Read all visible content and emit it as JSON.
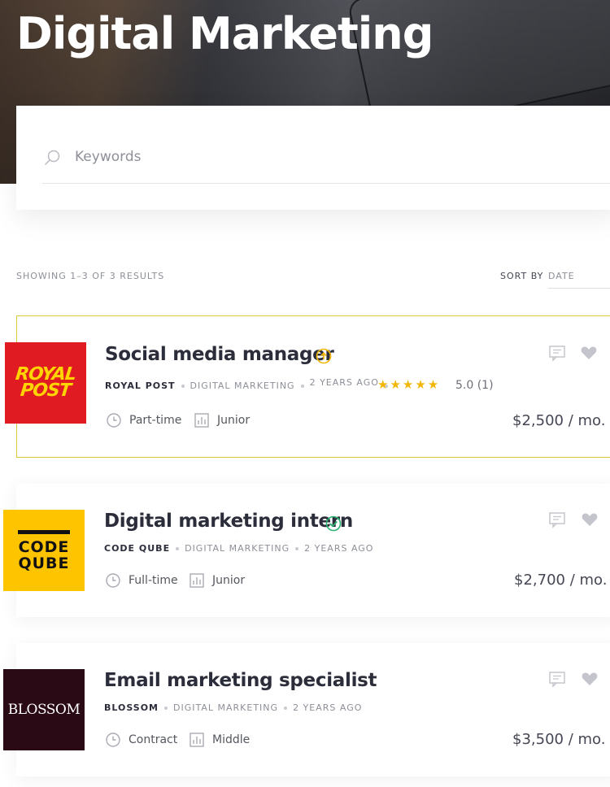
{
  "hero": {
    "title": "Digital Marketing"
  },
  "search": {
    "placeholder": "Keywords"
  },
  "results": {
    "showing": "SHOWING 1–3 OF 3 RESULTS",
    "sort_label": "SORT BY",
    "sort_value": "DATE"
  },
  "jobs": [
    {
      "title": "Social media manager",
      "badge": "featured-arrow-icon",
      "company": "ROYAL POST",
      "category": "DIGITAL MARKETING",
      "posted": "2 YEARS AGO",
      "stars": "★★★★★",
      "rating": "5.0 (1)",
      "type": "Part-time",
      "level": "Junior",
      "salary": "$2,500 / mo.",
      "logo_lines": [
        "ROYAL",
        "POST"
      ]
    },
    {
      "title": "Digital marketing intern",
      "badge": "verified-check-icon",
      "company": "CODE QUBE",
      "category": "DIGITAL MARKETING",
      "posted": "2 YEARS AGO",
      "type": "Full-time",
      "level": "Junior",
      "salary": "$2,700 / mo.",
      "logo_lines": [
        "CODE",
        "QUBE"
      ]
    },
    {
      "title": "Email marketing specialist",
      "company": "BLOSSOM",
      "category": "DIGITAL MARKETING",
      "posted": "2 YEARS AGO",
      "type": "Contract",
      "level": "Middle",
      "salary": "$3,500 / mo.",
      "logo_lines": [
        "BLOSSOM"
      ]
    }
  ],
  "colors": {
    "accent": "#f2b705",
    "verified": "#2ab06f",
    "featured_border": "#d8c93a",
    "royal_red": "#e11b22",
    "code_yellow": "#ffc400",
    "blossom_dark": "#2a0a14"
  }
}
